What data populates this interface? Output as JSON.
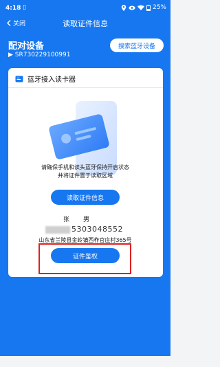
{
  "status_bar": {
    "time": "4:18",
    "sim_icon": "sim-card-icon",
    "battery": "25%"
  },
  "topbar": {
    "back_label": "关闭",
    "title": "读取证件信息"
  },
  "device": {
    "section_title": "配对设备",
    "serial": "▶ SR730229100991",
    "search_button": "搜索蓝牙设备"
  },
  "reader_card": {
    "header_label": "蓝牙接入读卡器",
    "instruction_line1": "请确保手机和读头蓝牙保持开启状态",
    "instruction_line2": "并将证件置于读取区域",
    "read_button": "读取证件信息",
    "name_partial": "张",
    "gender": "男",
    "id_number_visible": "5303048552",
    "address": "山东省兰陵县金岭镇西柞官庄村365号",
    "verify_button": "证件鉴权"
  },
  "colors": {
    "primary": "#1677f0",
    "highlight": "#e02020"
  }
}
